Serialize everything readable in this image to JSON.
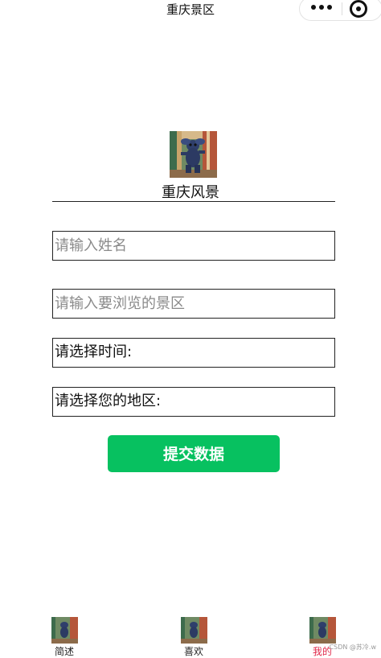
{
  "navbar": {
    "title": "重庆景区"
  },
  "page": {
    "heading": "重庆风景"
  },
  "form": {
    "name_placeholder": "请输入姓名",
    "scenic_placeholder": "请输入要浏览的景区",
    "time_label": "请选择时间:",
    "region_label": "请选择您的地区:",
    "submit_label": "提交数据"
  },
  "tabbar": {
    "items": [
      {
        "label": "简述",
        "icon": "stitch-character-icon",
        "active": false
      },
      {
        "label": "喜欢",
        "icon": "stitch-character-icon",
        "active": false
      },
      {
        "label": "我的",
        "icon": "stitch-character-icon",
        "active": true
      }
    ],
    "active_color": "#e0294a"
  },
  "watermark": "CSDN @苏冷.w",
  "colors": {
    "submit_button": "#07c160",
    "placeholder": "#8a8a8a",
    "border": "#222222"
  }
}
